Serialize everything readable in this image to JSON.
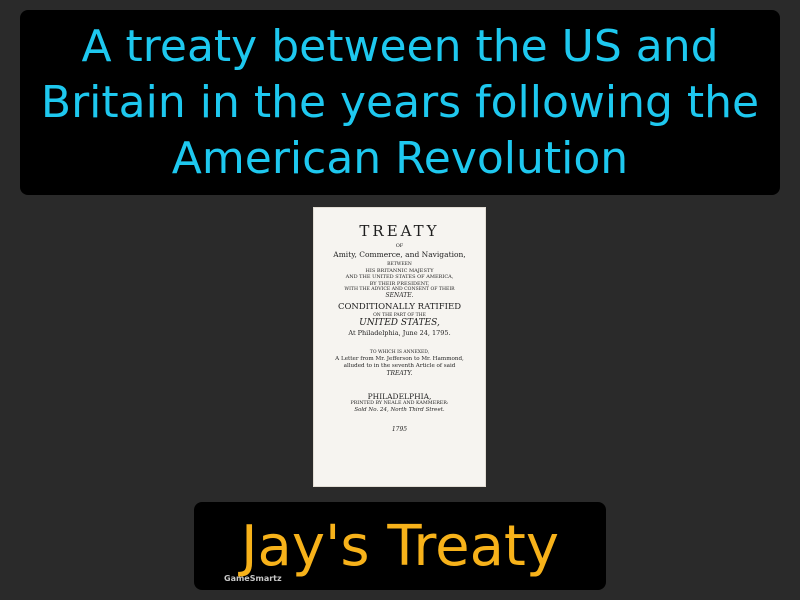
{
  "definition": "A treaty between the US and Britain in the years following the American Revolution",
  "term": "Jay's Treaty",
  "brand": "GameSmartz",
  "document": {
    "lines": [
      "TREATY",
      "OF",
      "Amity, Commerce, and Navigation,",
      "BETWEEN",
      "HIS BRITANNIC MAJESTY",
      "AND THE UNITED STATES OF AMERICA,",
      "BY THEIR PRESIDENT,",
      "WITH THE ADVICE AND CONSENT OF THEIR",
      "SENATE.",
      "CONDITIONALLY RATIFIED",
      "ON THE PART OF THE",
      "UNITED STATES,",
      "At Philadelphia, June 24, 1795.",
      "TO WHICH IS ANNEXED,",
      "A Letter from Mr. Jefferson to Mr. Hammond,",
      "alluded to in the seventh Article of said",
      "TREATY.",
      "PHILADELPHIA,",
      "PRINTED BY NEALE AND KAMMERER:",
      "Sold No. 24, North Third Street.",
      "1795"
    ]
  },
  "colors": {
    "definition": "#1ec8ef",
    "term": "#f7b21a",
    "background": "#2a2a2a",
    "panel": "#000000"
  }
}
